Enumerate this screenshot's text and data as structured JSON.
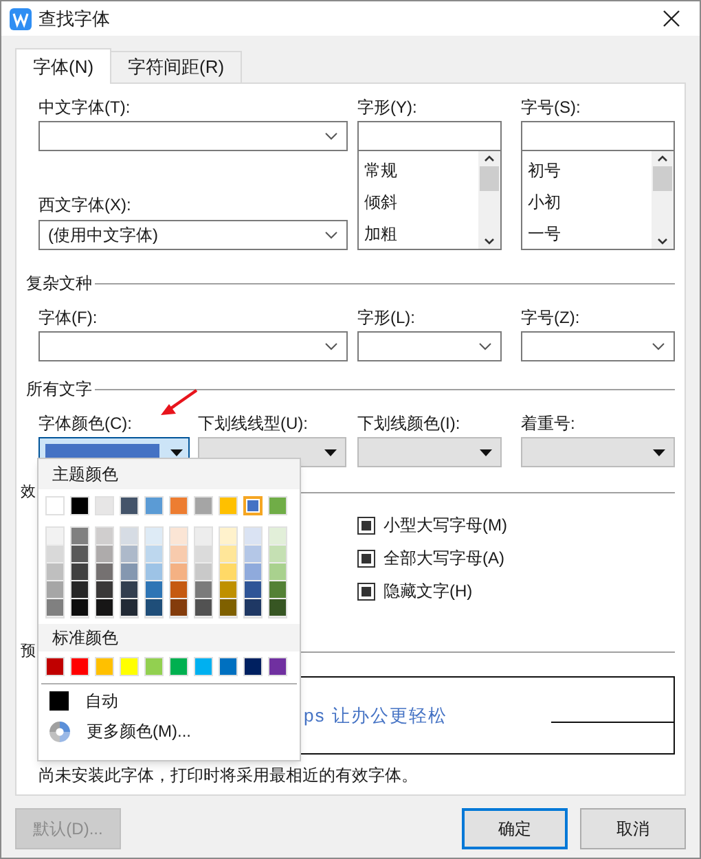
{
  "window": {
    "title": "查找字体"
  },
  "tabs": [
    {
      "label": "字体(N)",
      "selected": true
    },
    {
      "label": "字符间距(R)",
      "selected": false
    }
  ],
  "east_asian_font": {
    "label": "中文字体(T):"
  },
  "latin_font": {
    "label": "西文字体(X):",
    "value": "(使用中文字体)"
  },
  "font_style": {
    "label": "字形(Y):",
    "options": [
      "常规",
      "倾斜",
      "加粗"
    ]
  },
  "font_size": {
    "label": "字号(S):",
    "options": [
      "初号",
      "小初",
      "一号"
    ]
  },
  "complex_script": {
    "title": "复杂文种",
    "fields": [
      {
        "label": "字体(F):"
      },
      {
        "label": "字形(L):"
      },
      {
        "label": "字号(Z):"
      }
    ]
  },
  "all_text": {
    "title": "所有文字",
    "font_color": {
      "label": "字体颜色(C):",
      "color": "#4472c4"
    },
    "fields": [
      {
        "label": "下划线线型(U):",
        "disabled": true
      },
      {
        "label": "下划线颜色(I):",
        "disabled": true
      },
      {
        "label": "着重号:",
        "disabled": true
      }
    ]
  },
  "effects": {
    "title": "效",
    "options": [
      {
        "label": "小型大写字母(M)",
        "checked": true
      },
      {
        "label": "全部大写字母(A)",
        "checked": true
      },
      {
        "label": "隐藏文字(H)",
        "checked": true
      }
    ]
  },
  "preview": {
    "title": "预",
    "text": "ps 让办公更轻松"
  },
  "note": "尚未安装此字体，打印时将采用最相近的有效字体。",
  "color_menu": {
    "theme_title": "主题颜色",
    "theme_colors": [
      {
        "color": "#ffffff",
        "selected": false
      },
      {
        "color": "#000000",
        "selected": false
      },
      {
        "color": "#e7e6e6",
        "selected": false
      },
      {
        "color": "#44546a",
        "selected": false
      },
      {
        "color": "#5b9bd5",
        "selected": false
      },
      {
        "color": "#ed7d31",
        "selected": false
      },
      {
        "color": "#a5a5a5",
        "selected": false
      },
      {
        "color": "#ffc000",
        "selected": false
      },
      {
        "color": "#4472c4",
        "selected": true
      },
      {
        "color": "#70ad47",
        "selected": false
      }
    ],
    "shades": [
      {
        "colors": [
          {
            "color": "#f2f2f2"
          },
          {
            "color": "#d9d9d9"
          },
          {
            "color": "#bfbfbf"
          },
          {
            "color": "#a6a6a6"
          },
          {
            "color": "#808080"
          }
        ]
      },
      {
        "colors": [
          {
            "color": "#808080"
          },
          {
            "color": "#595959"
          },
          {
            "color": "#404040"
          },
          {
            "color": "#262626"
          },
          {
            "color": "#0d0d0d"
          }
        ]
      },
      {
        "colors": [
          {
            "color": "#d0cece"
          },
          {
            "color": "#aeabab"
          },
          {
            "color": "#757171"
          },
          {
            "color": "#3a3838"
          },
          {
            "color": "#171616"
          }
        ]
      },
      {
        "colors": [
          {
            "color": "#d6dce4"
          },
          {
            "color": "#adb9ca"
          },
          {
            "color": "#8497b0"
          },
          {
            "color": "#333f4f"
          },
          {
            "color": "#222a35"
          }
        ]
      },
      {
        "colors": [
          {
            "color": "#deebf6"
          },
          {
            "color": "#bdd7ee"
          },
          {
            "color": "#9dc3e6"
          },
          {
            "color": "#2e75b5"
          },
          {
            "color": "#1f4e79"
          }
        ]
      },
      {
        "colors": [
          {
            "color": "#fbe5d5"
          },
          {
            "color": "#f8cbad"
          },
          {
            "color": "#f4b183"
          },
          {
            "color": "#c55a11"
          },
          {
            "color": "#843c0b"
          }
        ]
      },
      {
        "colors": [
          {
            "color": "#ededed"
          },
          {
            "color": "#dbdbdb"
          },
          {
            "color": "#c9c9c9"
          },
          {
            "color": "#7b7b7b"
          },
          {
            "color": "#525252"
          }
        ]
      },
      {
        "colors": [
          {
            "color": "#fff2cc"
          },
          {
            "color": "#ffe699"
          },
          {
            "color": "#ffd966"
          },
          {
            "color": "#bf9000"
          },
          {
            "color": "#7f6000"
          }
        ]
      },
      {
        "colors": [
          {
            "color": "#dae3f3"
          },
          {
            "color": "#b4c7e7"
          },
          {
            "color": "#8faadc"
          },
          {
            "color": "#2f5597"
          },
          {
            "color": "#1f3864"
          }
        ]
      },
      {
        "colors": [
          {
            "color": "#e2efd9"
          },
          {
            "color": "#c5e0b3"
          },
          {
            "color": "#a9d18e"
          },
          {
            "color": "#538135"
          },
          {
            "color": "#375623"
          }
        ]
      }
    ],
    "standard_title": "标准颜色",
    "standard_colors": [
      {
        "color": "#c00000"
      },
      {
        "color": "#ff0000"
      },
      {
        "color": "#ffc000"
      },
      {
        "color": "#ffff00"
      },
      {
        "color": "#92d050"
      },
      {
        "color": "#00b050"
      },
      {
        "color": "#00b0f0"
      },
      {
        "color": "#0070c0"
      },
      {
        "color": "#002060"
      },
      {
        "color": "#7030a0"
      }
    ],
    "automatic": {
      "label": "自动",
      "color": "#000000"
    },
    "more": "更多颜色(M)..."
  },
  "buttons": [
    {
      "label": "默认(D)...",
      "disabled": true,
      "default": false
    },
    {
      "label": "确定",
      "disabled": false,
      "default": true
    },
    {
      "label": "取消",
      "disabled": false,
      "default": false
    }
  ]
}
